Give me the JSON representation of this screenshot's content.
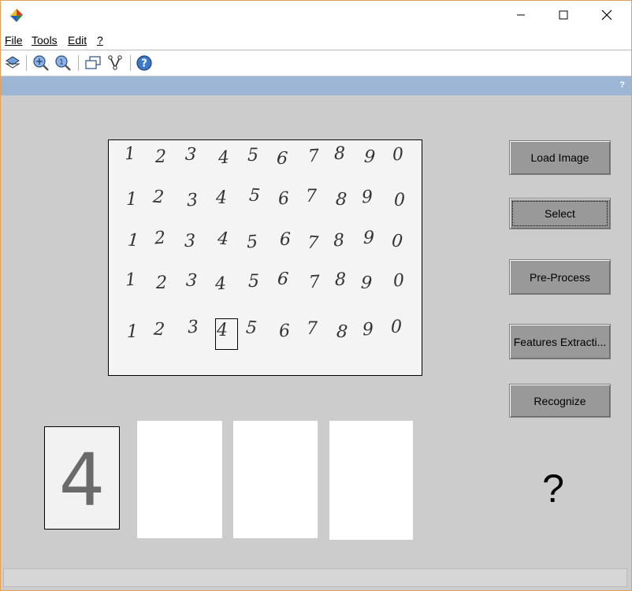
{
  "menu": {
    "file": "File",
    "tools": "Tools",
    "edit": "Edit",
    "help": "?"
  },
  "toolbar": {
    "icons": [
      "edit-icon",
      "zoom-in-icon",
      "zoom-out-icon",
      "windows-icon",
      "tree-icon",
      "help-icon"
    ]
  },
  "bluebar": {
    "help": "?"
  },
  "image": {
    "rows": [
      [
        "1",
        "2",
        "3",
        "4",
        "5",
        "6",
        "7",
        "8",
        "9",
        "0"
      ],
      [
        "1",
        "2",
        "3",
        "4",
        "5",
        "6",
        "7",
        "8",
        "9",
        "0"
      ],
      [
        "1",
        "2",
        "3",
        "4",
        "5",
        "6",
        "7",
        "8",
        "9",
        "0"
      ],
      [
        "1",
        "2",
        "3",
        "4",
        "5",
        "6",
        "7",
        "8",
        "9",
        "0"
      ],
      [
        "1",
        "2",
        "3",
        "4",
        "5",
        "6",
        "7",
        "8",
        "9",
        "0"
      ]
    ]
  },
  "buttons": {
    "load": "Load Image",
    "select": "Select",
    "preprocess": "Pre-Process",
    "features": "Features Extracti...",
    "recognize": "Recognize"
  },
  "thumbnail": {
    "digit": "4"
  },
  "result": {
    "text": "?"
  },
  "colors": {
    "background": "#cccccc",
    "bluebar": "#9db6d5",
    "button": "#999999"
  }
}
